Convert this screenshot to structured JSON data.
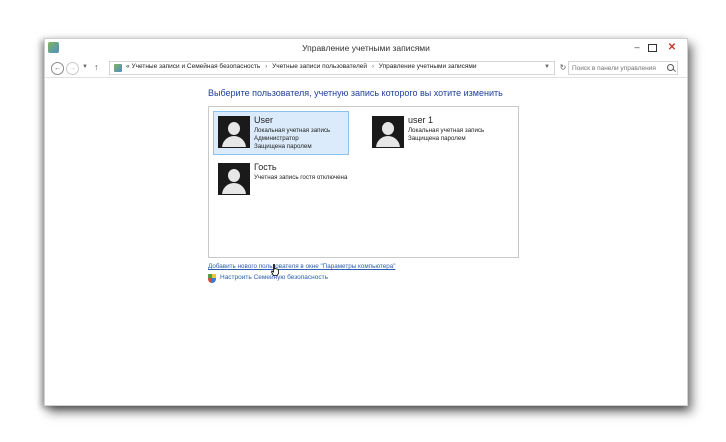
{
  "window": {
    "title": "Управление учетными записями",
    "controls": {
      "minimize": "–",
      "maximize": "",
      "close": "✕"
    }
  },
  "addressbar": {
    "back_icon": "arrow-left-icon",
    "forward_icon": "arrow-right-icon",
    "up_icon": "arrow-up-icon",
    "breadcrumbs": [
      "Учетные записи и Семейная безопасность",
      "Учетные записи пользователей",
      "Управление учетными записями"
    ],
    "prefix": "«",
    "separator": "›",
    "search_placeholder": "Поиск в панели управления"
  },
  "main": {
    "heading": "Выберите пользователя, учетную запись которого вы хотите изменить",
    "accounts": [
      {
        "name": "User",
        "lines": [
          "Локальная учетная запись",
          "Администратор",
          "Защищена паролем"
        ],
        "selected": true
      },
      {
        "name": "user 1",
        "lines": [
          "Локальная учетная запись",
          "Защищена паролем"
        ],
        "selected": false
      },
      {
        "name": "Гость",
        "lines": [
          "Учетная запись гостя отключена"
        ],
        "selected": false
      }
    ],
    "add_user_link": "Добавить нового пользователя в окне \"Параметры компьютера\"",
    "family_link": "Настроить Семейную безопасность"
  },
  "colors": {
    "heading": "#1e3f9c",
    "link": "#2a5db0",
    "selected_tile": "#dcebfb",
    "selected_border": "#8ec0ec"
  }
}
